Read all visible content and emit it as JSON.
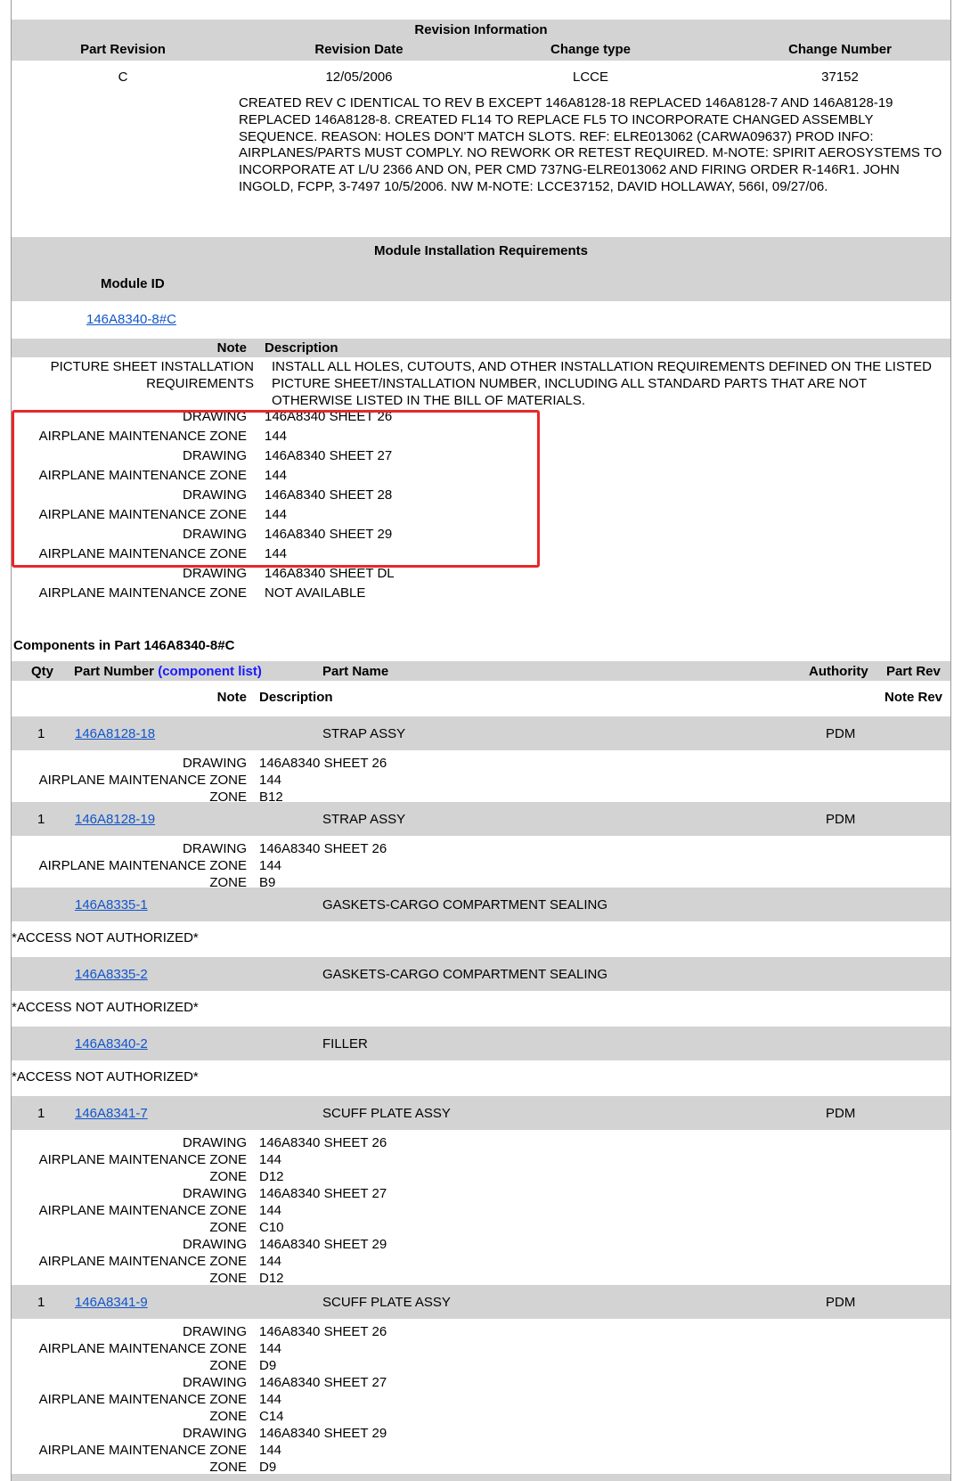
{
  "revision": {
    "title": "Revision Information",
    "headers": {
      "part_revision": "Part Revision",
      "revision_date": "Revision Date",
      "change_type": "Change type",
      "change_number": "Change Number"
    },
    "values": {
      "part_revision": "C",
      "revision_date": "12/05/2006",
      "change_type": "LCCE",
      "change_number": "37152"
    },
    "description": "CREATED REV C IDENTICAL TO REV B EXCEPT 146A8128-18 REPLACED 146A8128-7 AND 146A8128-19 REPLACED 146A8128-8. CREATED FL14 TO REPLACE FL5 TO INCORPORATE CHANGED ASSEMBLY SEQUENCE. REASON: HOLES DON'T MATCH SLOTS. REF: ELRE013062 (CARWA09637) PROD INFO: AIRPLANES/PARTS MUST COMPLY. NO REWORK OR RETEST REQUIRED. M-NOTE: SPIRIT AEROSYSTEMS TO INCORPORATE AT L/U 2366 AND ON, PER CMD 737NG-ELRE013062 AND FIRING ORDER R-146R1. JOHN INGOLD, FCPP, 3-7497 10/5/2006. NW M-NOTE: LCCE37152, DAVID HOLLAWAY, 566I, 09/27/06."
  },
  "module": {
    "title": "Module Installation Requirements",
    "id_label": "Module ID",
    "id_link": "146A8340-8#C",
    "note_header": "Note",
    "desc_header": "Description",
    "notes": [
      {
        "k": "PICTURE SHEET INSTALLATION REQUIREMENTS",
        "v": "INSTALL ALL HOLES, CUTOUTS, AND OTHER INSTALLATION REQUIREMENTS DEFINED ON THE LISTED PICTURE SHEET/INSTALLATION NUMBER, INCLUDING ALL STANDARD PARTS THAT ARE NOT OTHERWISE LISTED IN THE BILL OF MATERIALS."
      },
      {
        "k": "DRAWING",
        "v": "146A8340 SHEET 26"
      },
      {
        "k": "AIRPLANE MAINTENANCE ZONE",
        "v": "144"
      },
      {
        "k": "DRAWING",
        "v": "146A8340 SHEET 27"
      },
      {
        "k": "AIRPLANE MAINTENANCE ZONE",
        "v": "144"
      },
      {
        "k": "DRAWING",
        "v": "146A8340 SHEET 28"
      },
      {
        "k": "AIRPLANE MAINTENANCE ZONE",
        "v": "144"
      },
      {
        "k": "DRAWING",
        "v": "146A8340 SHEET 29"
      },
      {
        "k": "AIRPLANE MAINTENANCE ZONE",
        "v": "144"
      },
      {
        "k": "DRAWING",
        "v": "146A8340 SHEET DL"
      },
      {
        "k": "AIRPLANE MAINTENANCE ZONE",
        "v": "NOT AVAILABLE"
      }
    ]
  },
  "components": {
    "title": "Components in Part 146A8340-8#C",
    "headers": {
      "qty": "Qty",
      "part_number": "Part Number",
      "component_list": "(component list)",
      "part_name": "Part Name",
      "authority": "Authority",
      "part_rev": "Part Rev",
      "note": "Note",
      "description": "Description",
      "note_rev": "Note Rev"
    },
    "rows": [
      {
        "qty": "1",
        "pn": "146A8128-18",
        "name": "STRAP ASSY",
        "auth": "PDM",
        "details": [
          {
            "k": "DRAWING",
            "v": "146A8340 SHEET 26"
          },
          {
            "k": "AIRPLANE MAINTENANCE ZONE",
            "v": "144"
          },
          {
            "k": "ZONE",
            "v": "B12"
          }
        ]
      },
      {
        "qty": "1",
        "pn": "146A8128-19",
        "name": "STRAP ASSY",
        "auth": "PDM",
        "details": [
          {
            "k": "DRAWING",
            "v": "146A8340 SHEET 26"
          },
          {
            "k": "AIRPLANE MAINTENANCE ZONE",
            "v": "144"
          },
          {
            "k": "ZONE",
            "v": "B9"
          }
        ]
      },
      {
        "qty": "",
        "pn": "146A8335-1",
        "name": "GASKETS-CARGO COMPARTMENT SEALING",
        "auth": "",
        "noauth": "*ACCESS NOT AUTHORIZED*"
      },
      {
        "qty": "",
        "pn": "146A8335-2",
        "name": "GASKETS-CARGO COMPARTMENT SEALING",
        "auth": "",
        "noauth": "*ACCESS NOT AUTHORIZED*"
      },
      {
        "qty": "",
        "pn": "146A8340-2",
        "name": "FILLER",
        "auth": "",
        "noauth": "*ACCESS NOT AUTHORIZED*"
      },
      {
        "qty": "1",
        "pn": "146A8341-7",
        "name": "SCUFF PLATE ASSY",
        "auth": "PDM",
        "details": [
          {
            "k": "DRAWING",
            "v": "146A8340 SHEET 26"
          },
          {
            "k": "AIRPLANE MAINTENANCE ZONE",
            "v": "144"
          },
          {
            "k": "ZONE",
            "v": "D12"
          },
          {
            "k": "DRAWING",
            "v": "146A8340 SHEET 27"
          },
          {
            "k": "AIRPLANE MAINTENANCE ZONE",
            "v": "144"
          },
          {
            "k": "ZONE",
            "v": "C10"
          },
          {
            "k": "DRAWING",
            "v": "146A8340 SHEET 29"
          },
          {
            "k": "AIRPLANE MAINTENANCE ZONE",
            "v": "144"
          },
          {
            "k": "ZONE",
            "v": "D12"
          }
        ]
      },
      {
        "qty": "1",
        "pn": "146A8341-9",
        "name": "SCUFF PLATE ASSY",
        "auth": "PDM",
        "details": [
          {
            "k": "DRAWING",
            "v": "146A8340 SHEET 26"
          },
          {
            "k": "AIRPLANE MAINTENANCE ZONE",
            "v": "144"
          },
          {
            "k": "ZONE",
            "v": "D9"
          },
          {
            "k": "DRAWING",
            "v": "146A8340 SHEET 27"
          },
          {
            "k": "AIRPLANE MAINTENANCE ZONE",
            "v": "144"
          },
          {
            "k": "ZONE",
            "v": "C14"
          },
          {
            "k": "DRAWING",
            "v": "146A8340 SHEET 29"
          },
          {
            "k": "AIRPLANE MAINTENANCE ZONE",
            "v": "144"
          },
          {
            "k": "ZONE",
            "v": "D9"
          }
        ]
      }
    ]
  }
}
